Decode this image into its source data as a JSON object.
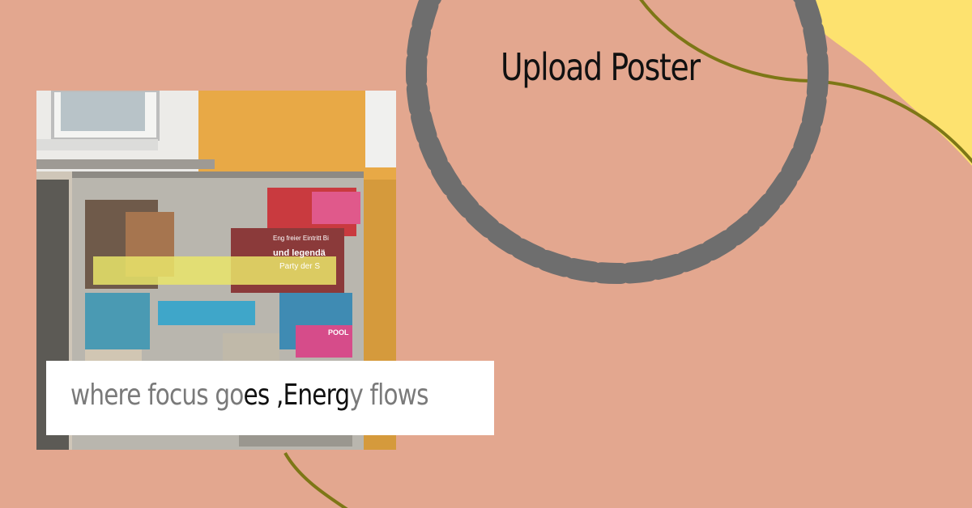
{
  "poster": {
    "title": "Upload Poster",
    "caption_parts": [
      {
        "text": "where focus go",
        "tone": "gray"
      },
      {
        "text": "es ,Energ",
        "tone": "dark"
      },
      {
        "text": "y flows",
        "tone": "gray"
      }
    ]
  },
  "photo": {
    "poster_text_1": "und legendä",
    "poster_text_2": "Party der S",
    "poster_text_3": "Eng freier Eintritt Bi",
    "poster_text_4": "POOL"
  },
  "colors": {
    "background": "#e3a78f",
    "yellow_blob": "#fde26f",
    "olive_curve": "#7d7716",
    "dashed_ring": "#6e6e6e",
    "caption_box": "#ffffff"
  },
  "icons": [
    "dashed-circle-decoration",
    "olive-curve-decoration",
    "yellow-blob-decoration"
  ]
}
